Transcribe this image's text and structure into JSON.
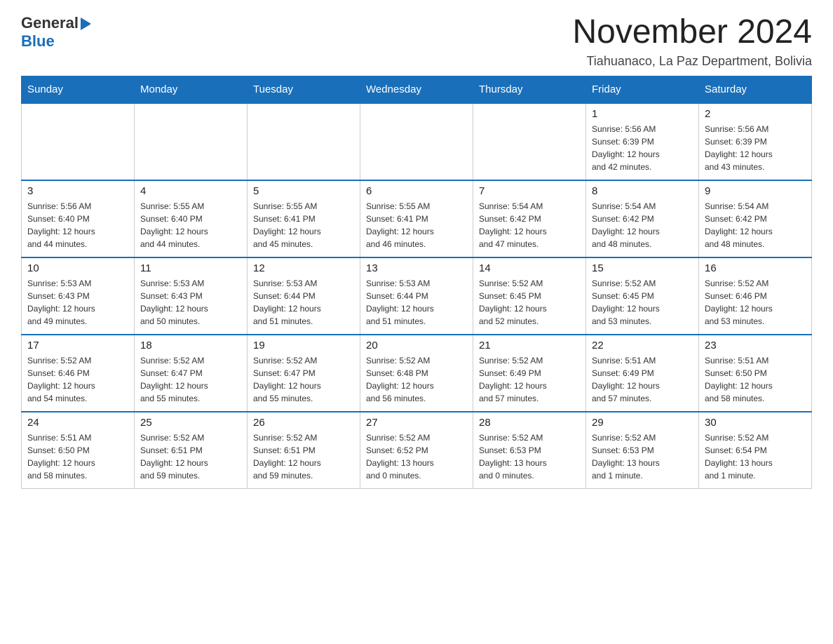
{
  "header": {
    "logo_general": "General",
    "logo_blue": "Blue",
    "main_title": "November 2024",
    "subtitle": "Tiahuanaco, La Paz Department, Bolivia"
  },
  "calendar": {
    "days_of_week": [
      "Sunday",
      "Monday",
      "Tuesday",
      "Wednesday",
      "Thursday",
      "Friday",
      "Saturday"
    ],
    "weeks": [
      [
        {
          "day": "",
          "info": ""
        },
        {
          "day": "",
          "info": ""
        },
        {
          "day": "",
          "info": ""
        },
        {
          "day": "",
          "info": ""
        },
        {
          "day": "",
          "info": ""
        },
        {
          "day": "1",
          "info": "Sunrise: 5:56 AM\nSunset: 6:39 PM\nDaylight: 12 hours\nand 42 minutes."
        },
        {
          "day": "2",
          "info": "Sunrise: 5:56 AM\nSunset: 6:39 PM\nDaylight: 12 hours\nand 43 minutes."
        }
      ],
      [
        {
          "day": "3",
          "info": "Sunrise: 5:56 AM\nSunset: 6:40 PM\nDaylight: 12 hours\nand 44 minutes."
        },
        {
          "day": "4",
          "info": "Sunrise: 5:55 AM\nSunset: 6:40 PM\nDaylight: 12 hours\nand 44 minutes."
        },
        {
          "day": "5",
          "info": "Sunrise: 5:55 AM\nSunset: 6:41 PM\nDaylight: 12 hours\nand 45 minutes."
        },
        {
          "day": "6",
          "info": "Sunrise: 5:55 AM\nSunset: 6:41 PM\nDaylight: 12 hours\nand 46 minutes."
        },
        {
          "day": "7",
          "info": "Sunrise: 5:54 AM\nSunset: 6:42 PM\nDaylight: 12 hours\nand 47 minutes."
        },
        {
          "day": "8",
          "info": "Sunrise: 5:54 AM\nSunset: 6:42 PM\nDaylight: 12 hours\nand 48 minutes."
        },
        {
          "day": "9",
          "info": "Sunrise: 5:54 AM\nSunset: 6:42 PM\nDaylight: 12 hours\nand 48 minutes."
        }
      ],
      [
        {
          "day": "10",
          "info": "Sunrise: 5:53 AM\nSunset: 6:43 PM\nDaylight: 12 hours\nand 49 minutes."
        },
        {
          "day": "11",
          "info": "Sunrise: 5:53 AM\nSunset: 6:43 PM\nDaylight: 12 hours\nand 50 minutes."
        },
        {
          "day": "12",
          "info": "Sunrise: 5:53 AM\nSunset: 6:44 PM\nDaylight: 12 hours\nand 51 minutes."
        },
        {
          "day": "13",
          "info": "Sunrise: 5:53 AM\nSunset: 6:44 PM\nDaylight: 12 hours\nand 51 minutes."
        },
        {
          "day": "14",
          "info": "Sunrise: 5:52 AM\nSunset: 6:45 PM\nDaylight: 12 hours\nand 52 minutes."
        },
        {
          "day": "15",
          "info": "Sunrise: 5:52 AM\nSunset: 6:45 PM\nDaylight: 12 hours\nand 53 minutes."
        },
        {
          "day": "16",
          "info": "Sunrise: 5:52 AM\nSunset: 6:46 PM\nDaylight: 12 hours\nand 53 minutes."
        }
      ],
      [
        {
          "day": "17",
          "info": "Sunrise: 5:52 AM\nSunset: 6:46 PM\nDaylight: 12 hours\nand 54 minutes."
        },
        {
          "day": "18",
          "info": "Sunrise: 5:52 AM\nSunset: 6:47 PM\nDaylight: 12 hours\nand 55 minutes."
        },
        {
          "day": "19",
          "info": "Sunrise: 5:52 AM\nSunset: 6:47 PM\nDaylight: 12 hours\nand 55 minutes."
        },
        {
          "day": "20",
          "info": "Sunrise: 5:52 AM\nSunset: 6:48 PM\nDaylight: 12 hours\nand 56 minutes."
        },
        {
          "day": "21",
          "info": "Sunrise: 5:52 AM\nSunset: 6:49 PM\nDaylight: 12 hours\nand 57 minutes."
        },
        {
          "day": "22",
          "info": "Sunrise: 5:51 AM\nSunset: 6:49 PM\nDaylight: 12 hours\nand 57 minutes."
        },
        {
          "day": "23",
          "info": "Sunrise: 5:51 AM\nSunset: 6:50 PM\nDaylight: 12 hours\nand 58 minutes."
        }
      ],
      [
        {
          "day": "24",
          "info": "Sunrise: 5:51 AM\nSunset: 6:50 PM\nDaylight: 12 hours\nand 58 minutes."
        },
        {
          "day": "25",
          "info": "Sunrise: 5:52 AM\nSunset: 6:51 PM\nDaylight: 12 hours\nand 59 minutes."
        },
        {
          "day": "26",
          "info": "Sunrise: 5:52 AM\nSunset: 6:51 PM\nDaylight: 12 hours\nand 59 minutes."
        },
        {
          "day": "27",
          "info": "Sunrise: 5:52 AM\nSunset: 6:52 PM\nDaylight: 13 hours\nand 0 minutes."
        },
        {
          "day": "28",
          "info": "Sunrise: 5:52 AM\nSunset: 6:53 PM\nDaylight: 13 hours\nand 0 minutes."
        },
        {
          "day": "29",
          "info": "Sunrise: 5:52 AM\nSunset: 6:53 PM\nDaylight: 13 hours\nand 1 minute."
        },
        {
          "day": "30",
          "info": "Sunrise: 5:52 AM\nSunset: 6:54 PM\nDaylight: 13 hours\nand 1 minute."
        }
      ]
    ]
  }
}
